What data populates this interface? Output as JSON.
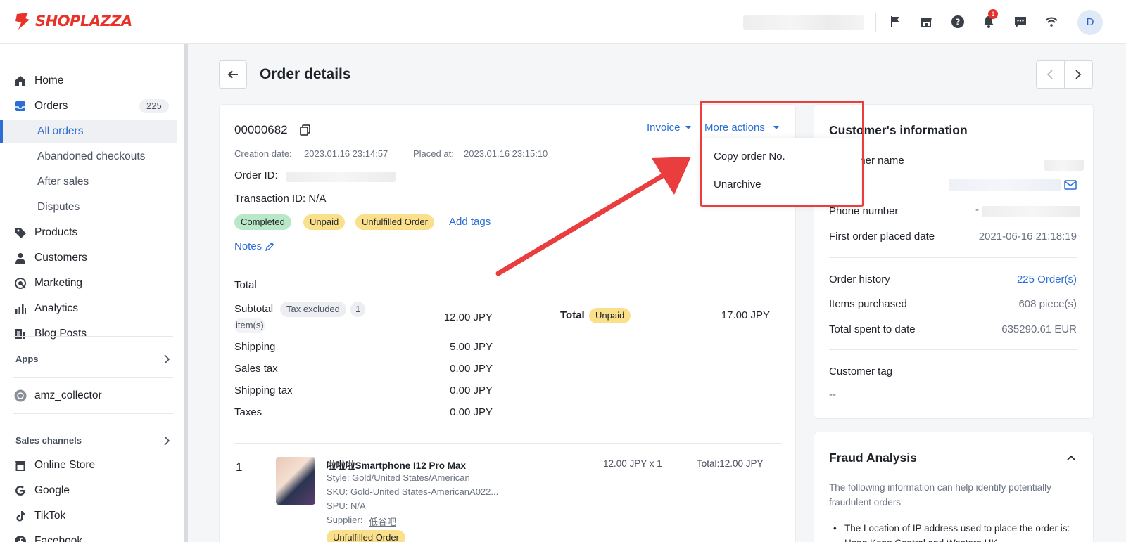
{
  "brand": {
    "name": "SHOPLAZZA",
    "color": "#e8332a"
  },
  "topbar": {
    "icons": [
      "flag-icon",
      "store-icon",
      "help-icon",
      "bell-icon",
      "chat-icon",
      "wifi-icon"
    ],
    "notification_count": "1",
    "avatar_initial": "D"
  },
  "sidebar": {
    "home": "Home",
    "orders": "Orders",
    "orders_count": "225",
    "all_orders": "All orders",
    "abandoned": "Abandoned checkouts",
    "after_sales": "After sales",
    "disputes": "Disputes",
    "products": "Products",
    "customers": "Customers",
    "marketing": "Marketing",
    "analytics": "Analytics",
    "blog_posts": "Blog Posts",
    "apps_label": "Apps",
    "app_item": "amz_collector",
    "sales_channels_label": "Sales channels",
    "online_store": "Online Store",
    "google": "Google",
    "tiktok": "TikTok",
    "facebook": "Facebook"
  },
  "page": {
    "title": "Order details"
  },
  "order": {
    "number": "00000682",
    "creation_label": "Creation date:",
    "creation_date": "2023.01.16 23:14:57",
    "placed_label": "Placed at:",
    "placed_date": "2023.01.16 23:15:10",
    "order_id_label": "Order ID:",
    "transaction": "Transaction ID: N/A",
    "tags": [
      "Completed",
      "Unpaid",
      "Unfulfilled Order"
    ],
    "add_tags": "Add tags",
    "notes": "Notes",
    "invoice": "Invoice",
    "more_actions": "More actions"
  },
  "more_actions_menu": [
    "Copy order No.",
    "Unarchive"
  ],
  "totals": {
    "heading": "Total",
    "subtotal_label": "Subtotal",
    "tax_excluded": "Tax excluded",
    "item_count": "1",
    "items_word": "item(s)",
    "subtotal": "12.00 JPY",
    "shipping_label": "Shipping",
    "shipping": "5.00 JPY",
    "sales_tax_label": "Sales tax",
    "sales_tax": "0.00 JPY",
    "shipping_tax_label": "Shipping tax",
    "shipping_tax": "0.00 JPY",
    "taxes_label": "Taxes",
    "taxes": "0.00 JPY",
    "total_label": "Total",
    "total_status": "Unpaid",
    "total": "17.00 JPY"
  },
  "line_item": {
    "index": "1",
    "name": "啦啦啦Smartphone I12 Pro Max",
    "style": "Style: Gold/United States/American",
    "sku": "SKU: Gold-United States-AmericanA022...",
    "spu": "SPU: N/A",
    "supplier_label": "Supplier:",
    "supplier": "低谷吧",
    "status": "Unfulfilled Order",
    "price_qty": "12.00 JPY x 1",
    "line_total": "Total:12.00 JPY"
  },
  "customer": {
    "title": "Customer's information",
    "name_label": "Customer name",
    "phone_label": "Phone number",
    "phone_prefix": "-",
    "first_order_label": "First order placed date",
    "first_order": "2021-06-16 21:18:19",
    "history_label": "Order history",
    "history": "225 Order(s)",
    "items_label": "Items purchased",
    "items": "608 piece(s)",
    "spent_label": "Total spent to date",
    "spent": "635290.61 EUR",
    "tag_label": "Customer tag",
    "tag_value": "--"
  },
  "fraud": {
    "title": "Fraud Analysis",
    "description": "The following information can help identify potentially fraudulent orders",
    "bullet": "The Location of IP address used to place the order is: Hong Kong Central and Western HK"
  }
}
